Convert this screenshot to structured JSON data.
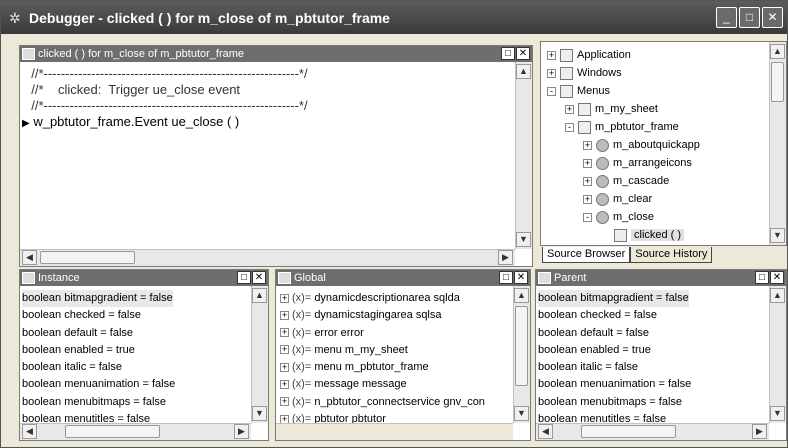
{
  "window": {
    "title": "Debugger - clicked ( ) for m_close of m_pbtutor_frame",
    "buttons": [
      "_",
      "□",
      "✕"
    ]
  },
  "script_pane": {
    "title": "clicked ( ) for m_close of m_pbtutor_frame",
    "lines": [
      "  //*-----------------------------------------------------------*/",
      "  //*    clicked:  Trigger ue_close event",
      "  //*-----------------------------------------------------------*/",
      "w_pbtutor_frame.Event ue_close ( )"
    ]
  },
  "tree": {
    "nodes": [
      {
        "label": "Application",
        "expander": "+",
        "icon": "app-icon"
      },
      {
        "label": "Windows",
        "expander": "+",
        "icon": "window-icon"
      },
      {
        "label": "Menus",
        "expander": "-",
        "icon": "menu-icon"
      },
      {
        "label": "m_my_sheet",
        "expander": "+",
        "icon": "menu-icon"
      },
      {
        "label": "m_pbtutor_frame",
        "expander": "-",
        "icon": "menu-icon"
      },
      {
        "label": "m_aboutquickapp",
        "expander": "+",
        "icon": "menuitem-icon"
      },
      {
        "label": "m_arrangeicons",
        "expander": "+",
        "icon": "menuitem-icon"
      },
      {
        "label": "m_cascade",
        "expander": "+",
        "icon": "menuitem-icon"
      },
      {
        "label": "m_clear",
        "expander": "+",
        "icon": "menuitem-icon"
      },
      {
        "label": "m_close",
        "expander": "-",
        "icon": "menuitem-icon"
      },
      {
        "label": "clicked ( )",
        "expander": "",
        "icon": "event-icon"
      }
    ],
    "tabs": [
      "Source Browser",
      "Source History"
    ]
  },
  "instance": {
    "title": "Instance",
    "items": [
      "boolean bitmapgradient = false",
      "boolean checked = false",
      "boolean default = false",
      "boolean enabled = true",
      "boolean italic = false",
      "boolean menuanimation = false",
      "boolean menubitmaps = false",
      "boolean menutitles = false"
    ]
  },
  "global": {
    "title": "Global",
    "items": [
      "dynamicdescriptionarea sqlda",
      "dynamicstagingarea sqlsa",
      "error error",
      "menu m_my_sheet",
      "menu m_pbtutor_frame",
      "message message",
      "n_pbtutor_connectservice gnv_con",
      "pbtutor pbtutor"
    ]
  },
  "parent": {
    "title": "Parent",
    "items": [
      "boolean bitmapgradient = false",
      "boolean checked = false",
      "boolean default = false",
      "boolean enabled = true",
      "boolean italic = false",
      "boolean menuanimation = false",
      "boolean menubitmaps = false",
      "boolean menutitles = false"
    ]
  }
}
